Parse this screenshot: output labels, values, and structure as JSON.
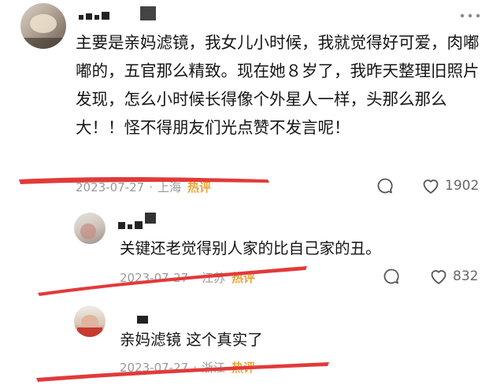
{
  "comments": [
    {
      "text": "主要是亲妈滤镜，我女儿小时候，我就觉得好可爱，肉嘟嘟的，五官那么精致。现在她８岁了，我昨天整理旧照片发现，怎么小时候长得像个外星人一样，头那么那么大！！怪不得朋友们光点赞不发言呢！",
      "date": "2023-07-27",
      "location": "上海",
      "badge": "热评",
      "likes": "1902"
    },
    {
      "text": "关键还老觉得别人家的比自己家的丑。",
      "date": "2023-07-27",
      "location": "江苏",
      "badge": "热评",
      "likes": "832"
    },
    {
      "text": "亲妈滤镜 这个真实了",
      "date": "2023-07-27",
      "location": "浙江",
      "badge": "热评"
    }
  ],
  "separator": "·",
  "colors": {
    "highlight_line": "#e23a3a",
    "hot_badge": "#e8a43a",
    "meta_text": "#9a9a9a"
  },
  "icons": [
    "more-dots-icon",
    "comment-bubble-icon",
    "heart-icon"
  ]
}
